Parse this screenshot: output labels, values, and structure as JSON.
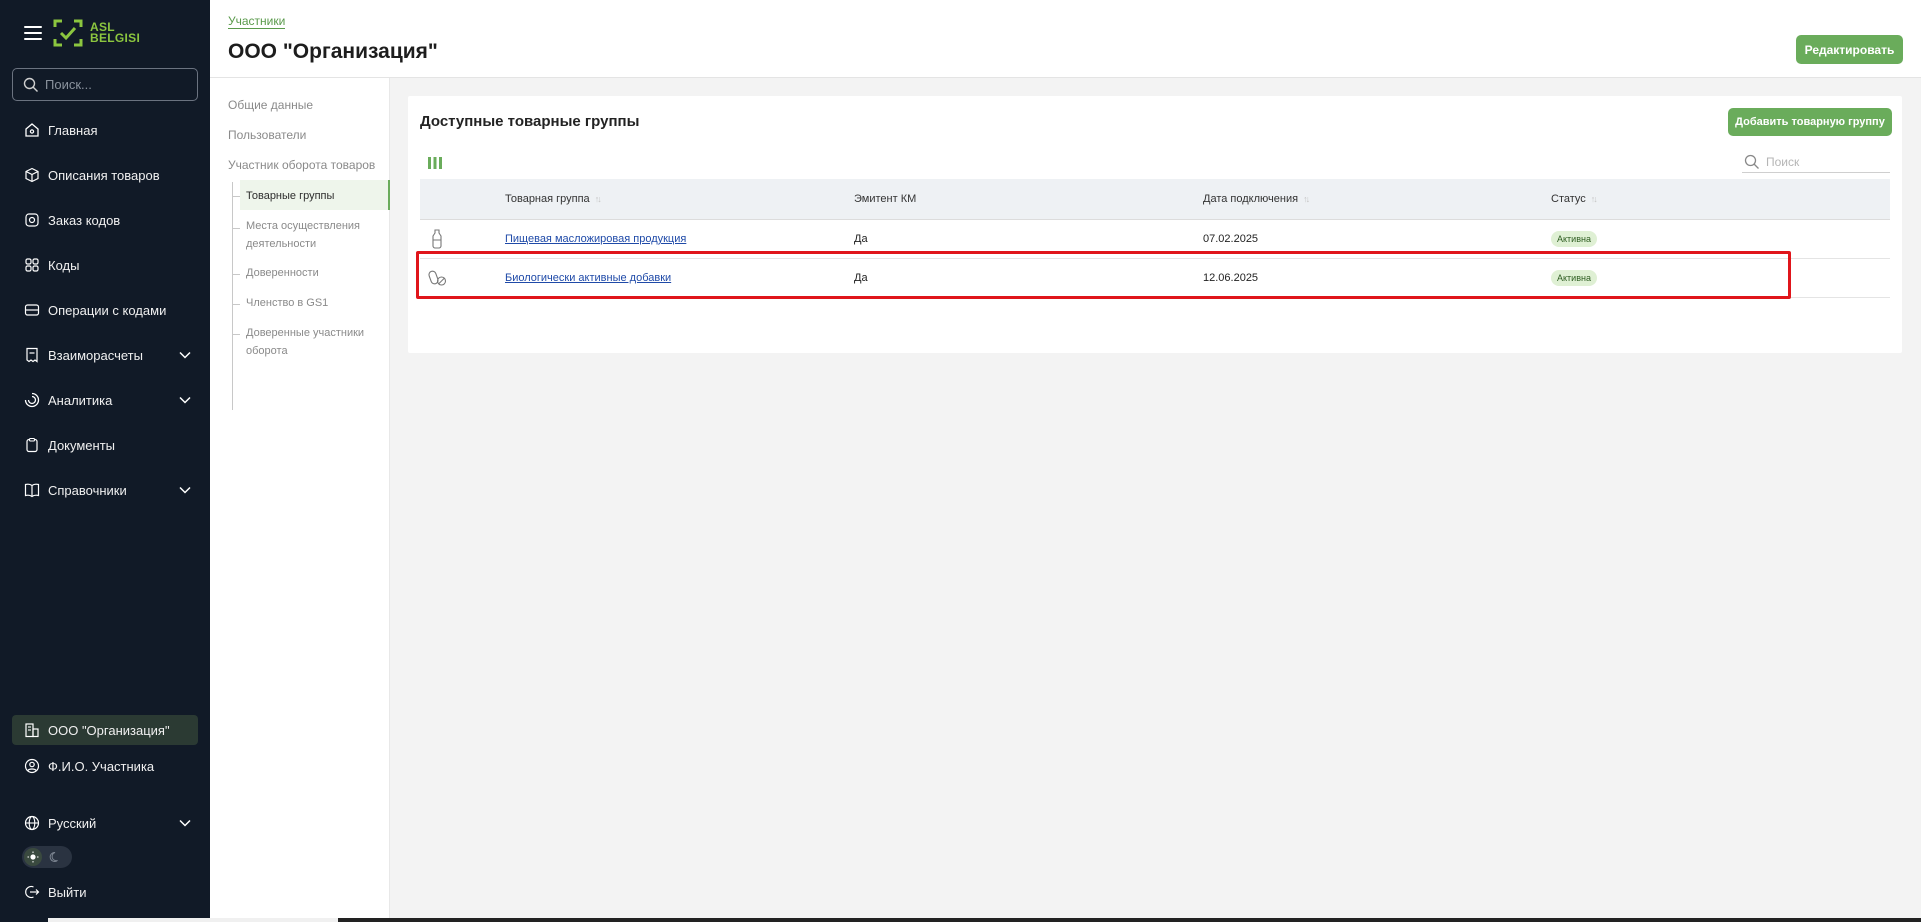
{
  "app": {
    "logo_line1": "ASL",
    "logo_line2": "BELGISI"
  },
  "sidebar": {
    "search_placeholder": "Поиск...",
    "items": [
      {
        "label": "Главная",
        "icon": "home-icon"
      },
      {
        "label": "Описания товаров",
        "icon": "box-icon"
      },
      {
        "label": "Заказ кодов",
        "icon": "order-icon"
      },
      {
        "label": "Коды",
        "icon": "codes-icon"
      },
      {
        "label": "Операции с кодами",
        "icon": "operations-icon"
      },
      {
        "label": "Взаиморасчеты",
        "icon": "receipt-icon"
      },
      {
        "label": "Аналитика",
        "icon": "analytics-icon"
      },
      {
        "label": "Документы",
        "icon": "documents-icon"
      },
      {
        "label": "Справочники",
        "icon": "book-icon"
      }
    ],
    "org_label": "ООО \"Организация\"",
    "user_label": "Ф.И.О. Участника",
    "language_label": "Русский",
    "logout_label": "Выйти"
  },
  "header": {
    "breadcrumb": "Участники",
    "title": "ООО \"Организация\"",
    "edit_label": "Редактировать"
  },
  "subnav": {
    "general": "Общие данные",
    "users": "Пользователи",
    "participant": "Участник оборота товаров",
    "children": [
      "Товарные группы",
      "Места осуществления деятельности",
      "Доверенности",
      "Членство в GS1",
      "Доверенные участники оборота"
    ]
  },
  "card": {
    "title": "Доступные товарные группы",
    "add_label": "Добавить товарную группу",
    "search_placeholder": "Поиск"
  },
  "table": {
    "headers": [
      "Товарная группа",
      "Эмитент КМ",
      "Дата подключения",
      "Статус"
    ],
    "rows": [
      {
        "icon": "bottle-icon",
        "group": "Пищевая масложировая продукция",
        "emitter": "Да",
        "date": "07.02.2025",
        "status": "Активна"
      },
      {
        "icon": "pills-icon",
        "group": "Биологически активные добавки",
        "emitter": "Да",
        "date": "12.06.2025",
        "status": "Активна"
      }
    ]
  },
  "colors": {
    "sidebar_bg": "#111a27",
    "accent_green": "#6aac5b",
    "highlight_red": "#e0151b",
    "link_blue": "#1f4aa8"
  }
}
